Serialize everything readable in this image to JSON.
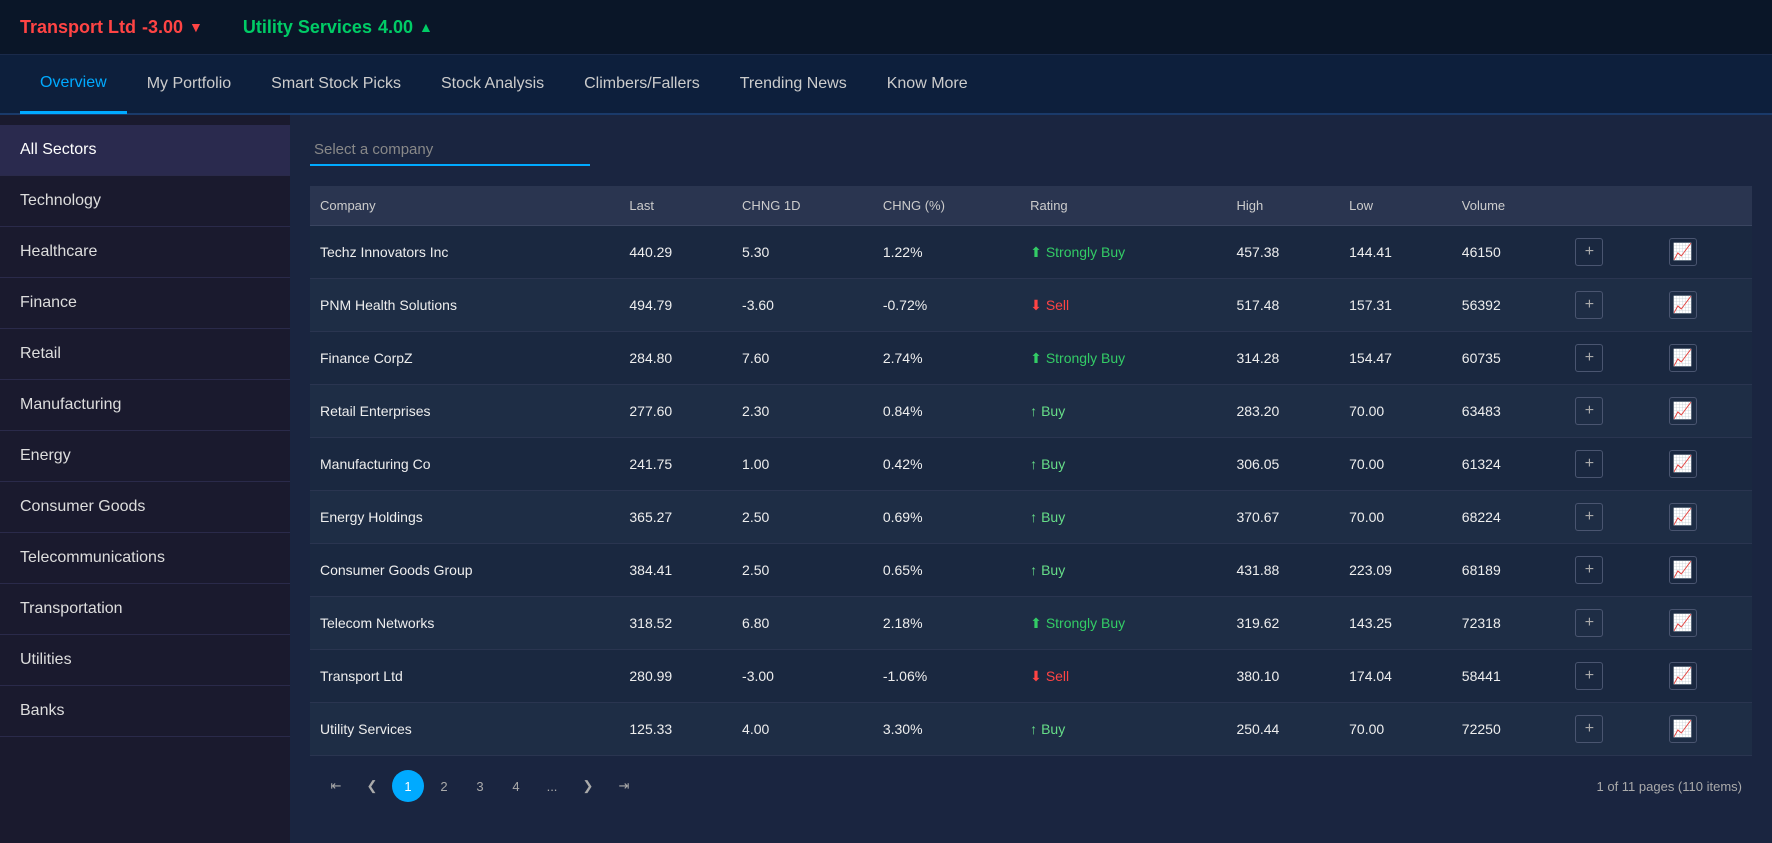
{
  "ticker": {
    "item1": {
      "name": "Transport Ltd",
      "change": "-3.00",
      "direction": "down"
    },
    "item2": {
      "name": "Utility Services",
      "change": "4.00",
      "direction": "up"
    }
  },
  "nav": {
    "items": [
      {
        "label": "Overview",
        "active": true
      },
      {
        "label": "My Portfolio",
        "active": false
      },
      {
        "label": "Smart Stock Picks",
        "active": false
      },
      {
        "label": "Stock Analysis",
        "active": false
      },
      {
        "label": "Climbers/Fallers",
        "active": false
      },
      {
        "label": "Trending News",
        "active": false
      },
      {
        "label": "Know More",
        "active": false
      }
    ]
  },
  "sidebar": {
    "items": [
      {
        "label": "All Sectors",
        "active": true
      },
      {
        "label": "Technology",
        "active": false
      },
      {
        "label": "Healthcare",
        "active": false
      },
      {
        "label": "Finance",
        "active": false
      },
      {
        "label": "Retail",
        "active": false
      },
      {
        "label": "Manufacturing",
        "active": false
      },
      {
        "label": "Energy",
        "active": false
      },
      {
        "label": "Consumer Goods",
        "active": false
      },
      {
        "label": "Telecommunications",
        "active": false
      },
      {
        "label": "Transportation",
        "active": false
      },
      {
        "label": "Utilities",
        "active": false
      },
      {
        "label": "Banks",
        "active": false
      }
    ]
  },
  "search": {
    "placeholder": "Select a company"
  },
  "table": {
    "headers": [
      "Company",
      "Last",
      "CHNG 1D",
      "CHNG (%)",
      "Rating",
      "High",
      "Low",
      "Volume",
      "",
      ""
    ],
    "rows": [
      {
        "company": "Techz Innovators Inc",
        "last": "440.29",
        "chng1d": "5.30",
        "chngPct": "1.22%",
        "rating": "Strongly Buy",
        "ratingType": "strong-buy",
        "high": "457.38",
        "low": "144.41",
        "volume": "46150"
      },
      {
        "company": "PNM Health Solutions",
        "last": "494.79",
        "chng1d": "-3.60",
        "chngPct": "-0.72%",
        "rating": "Sell",
        "ratingType": "sell",
        "high": "517.48",
        "low": "157.31",
        "volume": "56392"
      },
      {
        "company": "Finance CorpZ",
        "last": "284.80",
        "chng1d": "7.60",
        "chngPct": "2.74%",
        "rating": "Strongly Buy",
        "ratingType": "strong-buy",
        "high": "314.28",
        "low": "154.47",
        "volume": "60735"
      },
      {
        "company": "Retail Enterprises",
        "last": "277.60",
        "chng1d": "2.30",
        "chngPct": "0.84%",
        "rating": "Buy",
        "ratingType": "buy",
        "high": "283.20",
        "low": "70.00",
        "volume": "63483"
      },
      {
        "company": "Manufacturing Co",
        "last": "241.75",
        "chng1d": "1.00",
        "chngPct": "0.42%",
        "rating": "Buy",
        "ratingType": "buy",
        "high": "306.05",
        "low": "70.00",
        "volume": "61324"
      },
      {
        "company": "Energy Holdings",
        "last": "365.27",
        "chng1d": "2.50",
        "chngPct": "0.69%",
        "rating": "Buy",
        "ratingType": "buy",
        "high": "370.67",
        "low": "70.00",
        "volume": "68224"
      },
      {
        "company": "Consumer Goods Group",
        "last": "384.41",
        "chng1d": "2.50",
        "chngPct": "0.65%",
        "rating": "Buy",
        "ratingType": "buy",
        "high": "431.88",
        "low": "223.09",
        "volume": "68189"
      },
      {
        "company": "Telecom Networks",
        "last": "318.52",
        "chng1d": "6.80",
        "chngPct": "2.18%",
        "rating": "Strongly Buy",
        "ratingType": "strong-buy",
        "high": "319.62",
        "low": "143.25",
        "volume": "72318"
      },
      {
        "company": "Transport Ltd",
        "last": "280.99",
        "chng1d": "-3.00",
        "chngPct": "-1.06%",
        "rating": "Sell",
        "ratingType": "sell",
        "high": "380.10",
        "low": "174.04",
        "volume": "58441"
      },
      {
        "company": "Utility Services",
        "last": "125.33",
        "chng1d": "4.00",
        "chngPct": "3.30%",
        "rating": "Buy",
        "ratingType": "buy",
        "high": "250.44",
        "low": "70.00",
        "volume": "72250"
      }
    ]
  },
  "pagination": {
    "current": 1,
    "pages": [
      "1",
      "2",
      "3",
      "4",
      "..."
    ],
    "info": "1 of 11 pages (110 items)"
  }
}
